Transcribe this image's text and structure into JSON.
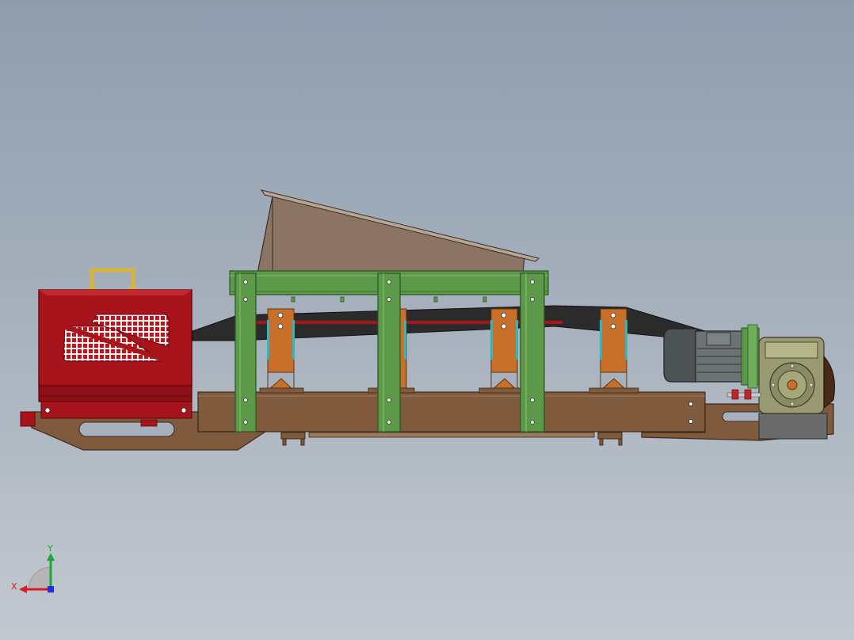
{
  "viewport": {
    "background_top": "#8f9dae",
    "background_bottom": "#c2c8cf"
  },
  "model": {
    "colors": {
      "frame_brown": "#7f5a3c",
      "frame_brown_dark": "#5e412a",
      "support_green": "#5c9a4a",
      "support_green_dark": "#3b6e30",
      "guard_red": "#a8141c",
      "guard_red_dark": "#6e0c11",
      "hopper": "#8b7464",
      "belt": "#2b2b2b",
      "roller_orange": "#c8702a",
      "roller_cyan": "#2fb7c0",
      "handle_yellow": "#d9b23a",
      "motor_grey": "#6d7274",
      "gearbox": "#9a9a72"
    }
  },
  "triad": {
    "x_label": "X",
    "y_label": "Y",
    "x_color": "#d81e1e",
    "y_color": "#1ea43a",
    "z_color": "#1e2ed8"
  }
}
